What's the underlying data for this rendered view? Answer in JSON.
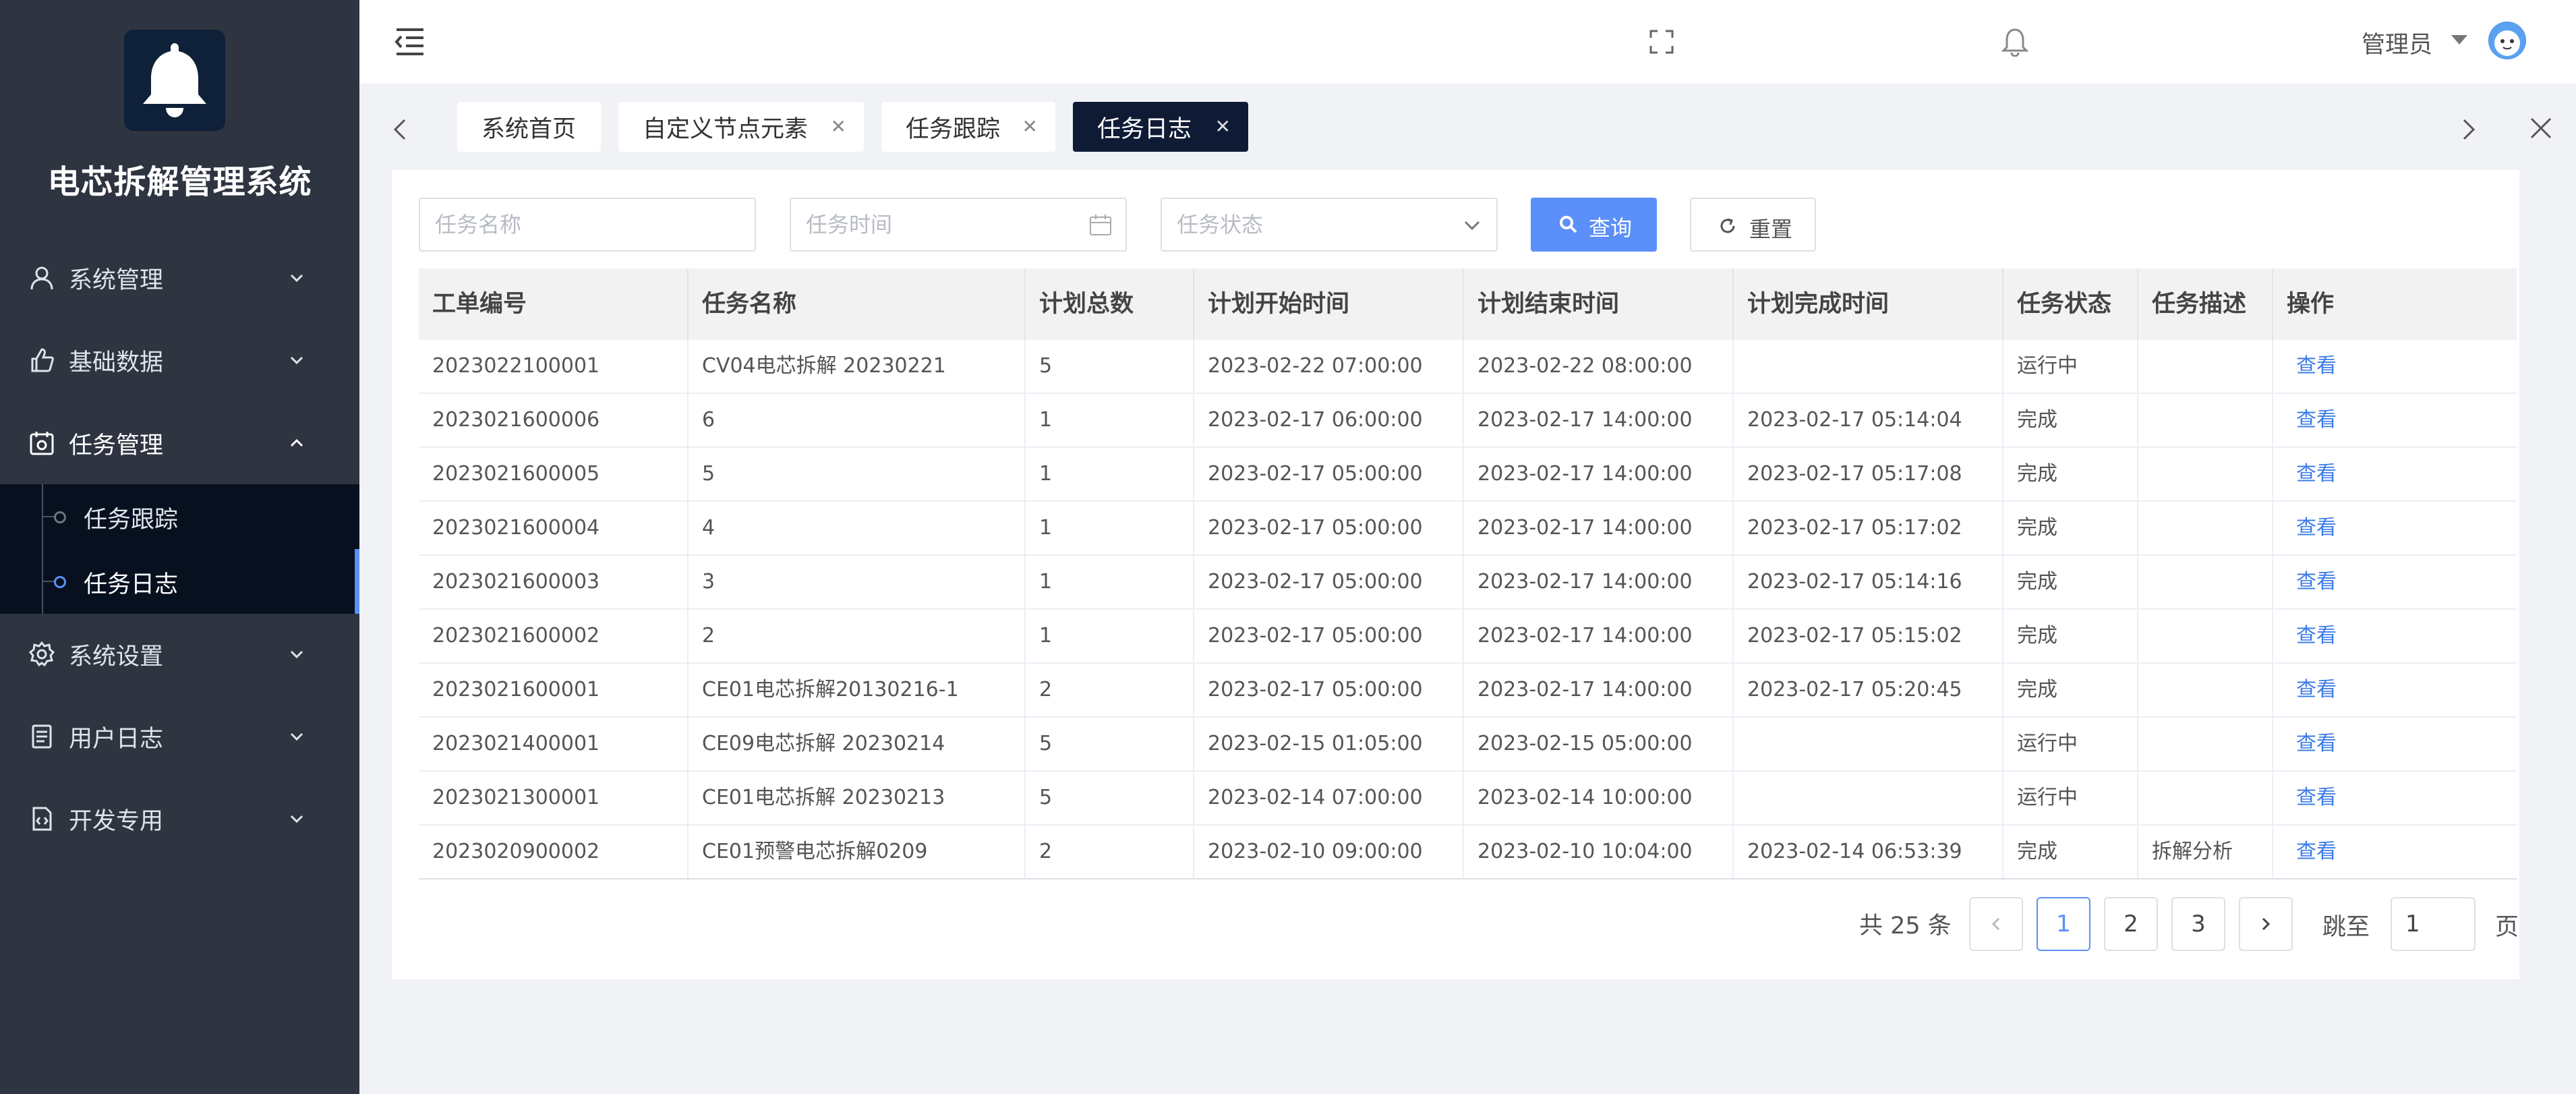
{
  "app": {
    "title": "电芯拆解管理系统"
  },
  "sidebar": {
    "items": [
      {
        "label": "系统管理"
      },
      {
        "label": "基础数据"
      },
      {
        "label": "任务管理"
      },
      {
        "label": "系统设置"
      },
      {
        "label": "用户日志"
      },
      {
        "label": "开发专用"
      }
    ],
    "subitems": [
      {
        "label": "任务跟踪"
      },
      {
        "label": "任务日志"
      }
    ]
  },
  "header": {
    "user": "管理员"
  },
  "tabs": [
    {
      "label": "系统首页"
    },
    {
      "label": "自定义节点元素"
    },
    {
      "label": "任务跟踪"
    },
    {
      "label": "任务日志"
    }
  ],
  "filters": {
    "name_placeholder": "任务名称",
    "time_placeholder": "任务时间",
    "status_placeholder": "任务状态",
    "query_label": "查询",
    "reset_label": "重置"
  },
  "table": {
    "columns": [
      "工单编号",
      "任务名称",
      "计划总数",
      "计划开始时间",
      "计划结束时间",
      "计划完成时间",
      "任务状态",
      "任务描述",
      "操作"
    ],
    "rows": [
      [
        "2023022100001",
        "CV04电芯拆解 20230221",
        "5",
        "2023-02-22 07:00:00",
        "2023-02-22 08:00:00",
        "",
        "运行中",
        "",
        "查看"
      ],
      [
        "2023021600006",
        "6",
        "1",
        "2023-02-17 06:00:00",
        "2023-02-17 14:00:00",
        "2023-02-17 05:14:04",
        "完成",
        "",
        "查看"
      ],
      [
        "2023021600005",
        "5",
        "1",
        "2023-02-17 05:00:00",
        "2023-02-17 14:00:00",
        "2023-02-17 05:17:08",
        "完成",
        "",
        "查看"
      ],
      [
        "2023021600004",
        "4",
        "1",
        "2023-02-17 05:00:00",
        "2023-02-17 14:00:00",
        "2023-02-17 05:17:02",
        "完成",
        "",
        "查看"
      ],
      [
        "2023021600003",
        "3",
        "1",
        "2023-02-17 05:00:00",
        "2023-02-17 14:00:00",
        "2023-02-17 05:14:16",
        "完成",
        "",
        "查看"
      ],
      [
        "2023021600002",
        "2",
        "1",
        "2023-02-17 05:00:00",
        "2023-02-17 14:00:00",
        "2023-02-17 05:15:02",
        "完成",
        "",
        "查看"
      ],
      [
        "2023021600001",
        "CE01电芯拆解20130216-1",
        "2",
        "2023-02-17 05:00:00",
        "2023-02-17 14:00:00",
        "2023-02-17 05:20:45",
        "完成",
        "",
        "查看"
      ],
      [
        "2023021400001",
        "CE09电芯拆解 20230214",
        "5",
        "2023-02-15 01:05:00",
        "2023-02-15 05:00:00",
        "",
        "运行中",
        "",
        "查看"
      ],
      [
        "2023021300001",
        "CE01电芯拆解 20230213",
        "5",
        "2023-02-14 07:00:00",
        "2023-02-14 10:00:00",
        "",
        "运行中",
        "",
        "查看"
      ],
      [
        "2023020900002",
        "CE01预警电芯拆解0209",
        "2",
        "2023-02-10 09:00:00",
        "2023-02-10 10:04:00",
        "2023-02-14 06:53:39",
        "完成",
        "拆解分析",
        "查看"
      ]
    ]
  },
  "pagination": {
    "total_text": "共 25 条",
    "pages": [
      "1",
      "2",
      "3"
    ],
    "jump_label": "跳至",
    "jump_value": "1",
    "page_suffix": "页"
  },
  "colors": {
    "accent": "#5b8ff9",
    "sidebar_bg": "#2f3441",
    "tab_active": "#0f1b35"
  }
}
